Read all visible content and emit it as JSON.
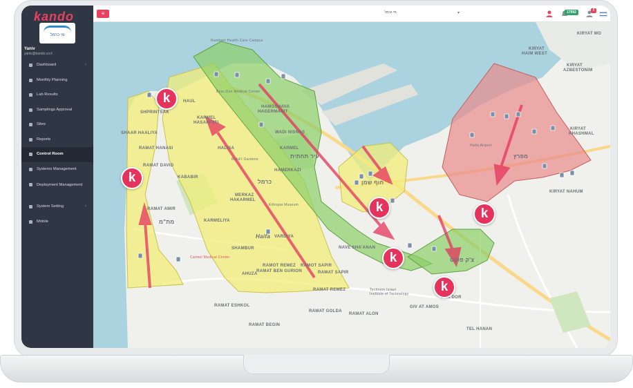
{
  "app": {
    "brand": "kando",
    "logo_text": "מי כרמל",
    "user_name": "Yaniv",
    "user_email": "yaniv@kando.co.il"
  },
  "sidebar": {
    "items": [
      {
        "label": "Dashboard",
        "icon": "dashboard-icon",
        "chevron": "‹"
      },
      {
        "label": "Monthly Planning",
        "icon": "calendar-icon"
      },
      {
        "label": "Lab Results",
        "icon": "flask-icon"
      },
      {
        "label": "Samplings Approval",
        "icon": "envelope-icon"
      },
      {
        "label": "Sites",
        "icon": "bar-chart-icon"
      },
      {
        "label": "Reports",
        "icon": "chart-icon"
      },
      {
        "label": "Control Room",
        "icon": "location-pin-icon",
        "active": true
      },
      {
        "label": "Systems Management",
        "icon": "wifi-icon"
      },
      {
        "label": "Deployment Management",
        "icon": "device-icon"
      },
      {
        "label": "System Setting",
        "icon": "gears-icon",
        "chevron": "‹"
      },
      {
        "label": "Mobile",
        "icon": "mobile-icon"
      }
    ]
  },
  "topbar": {
    "menu_icon": "hamburger-icon",
    "site_selector": "מי כרמל",
    "notifications_count": "17992",
    "alerts_count": "9"
  },
  "map": {
    "marker_letter": "k",
    "labels": [
      {
        "text": "KIRYAT MO"
      },
      {
        "text": "KIRYAT"
      },
      {
        "text": "HAIM WEST"
      },
      {
        "text": "KIRYAT"
      },
      {
        "text": "AZBESTONIM"
      },
      {
        "text": "KIRYAT"
      },
      {
        "text": "KHASHMAL"
      },
      {
        "text": "KIRYAT NAHUM"
      },
      {
        "text": "HAUL"
      },
      {
        "text": "SHPRINTSAK"
      },
      {
        "text": "SHAAR HAALIYA"
      },
      {
        "text": "RAMAT HANASI"
      },
      {
        "text": "RAMAT DAVID"
      },
      {
        "text": "KARMEL"
      },
      {
        "text": "HASARFATI"
      },
      {
        "text": "HAMOSHAVA"
      },
      {
        "text": "HAGERMANIT"
      },
      {
        "text": "WADI NISNAS"
      },
      {
        "text": "HALISA"
      },
      {
        "text": "KARMEL"
      },
      {
        "text": "HAMERKAZI"
      },
      {
        "text": "KABABIR"
      },
      {
        "text": "RAMAT SAPIR"
      },
      {
        "text": "RAMAT AMIR"
      },
      {
        "text": "MERKAZ"
      },
      {
        "text": "HAKARMEL"
      },
      {
        "text": "KARMELIYA"
      },
      {
        "text": "SHAMBUR"
      },
      {
        "text": "Haifa"
      },
      {
        "text": "VARDIYA"
      },
      {
        "text": "RAMAT REMEZ"
      },
      {
        "text": "RAMAT ESHKOL"
      },
      {
        "text": "RAMAT ALON"
      },
      {
        "text": "RAMAT BEGIN"
      },
      {
        "text": "RAMAT GOLDA"
      },
      {
        "text": "GIV AT AMOS"
      },
      {
        "text": "BEN DOR"
      },
      {
        "text": "TEL HANAN"
      },
      {
        "text": "NAVE SHA'ANAN"
      },
      {
        "text": "AHUZA"
      },
      {
        "text": "RAMOT REMEZ"
      },
      {
        "text": "RAMOT SAPIR"
      },
      {
        "text": "RAMAT BEN GURION"
      },
      {
        "text": "כרמל"
      },
      {
        "text": "עיר תחתית"
      },
      {
        "text": "חוף שמן"
      },
      {
        "text": "מפרץ"
      },
      {
        "text": "צ'ק פוסט"
      },
      {
        "text": "מת\"מ"
      },
      {
        "text": "Technion Israel Institute of Technology"
      },
      {
        "text": "Carmel Medical Center"
      },
      {
        "text": "Rambam Health Care Campus"
      },
      {
        "text": "Bnai Zion Medical Center"
      },
      {
        "text": "Bahá'í Gardens"
      },
      {
        "text": "Ethiopia Museum"
      },
      {
        "text": "Haifa Airport"
      }
    ]
  },
  "colors": {
    "accent": "#e4345d",
    "sidebar": "#2f3744",
    "sea": "#aad3df",
    "zone_yellow": "#f2ee7a",
    "zone_green": "#8ccf6a",
    "zone_red": "#e88a8a"
  }
}
